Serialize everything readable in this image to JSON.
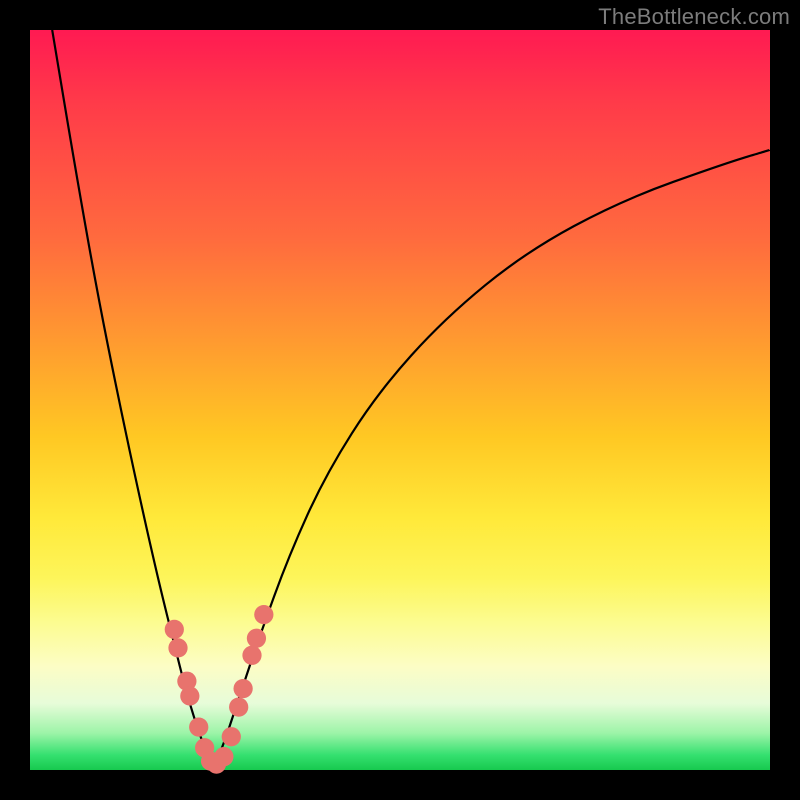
{
  "watermark": "TheBottleneck.com",
  "colors": {
    "curve": "#000000",
    "marker": "#e8736d",
    "frame": "#000000"
  },
  "chart_data": {
    "type": "line",
    "title": "",
    "xlabel": "",
    "ylabel": "",
    "xlim": [
      0,
      1
    ],
    "ylim": [
      0,
      1
    ],
    "annotations": [
      "TheBottleneck.com"
    ],
    "series": [
      {
        "name": "bottleneck-curve-left",
        "x": [
          0.03,
          0.06,
          0.09,
          0.12,
          0.15,
          0.175,
          0.195,
          0.21,
          0.225,
          0.238,
          0.248
        ],
        "y": [
          1.0,
          0.82,
          0.65,
          0.5,
          0.36,
          0.25,
          0.17,
          0.11,
          0.06,
          0.025,
          0.005
        ]
      },
      {
        "name": "bottleneck-curve-right",
        "x": [
          0.248,
          0.26,
          0.28,
          0.31,
          0.35,
          0.4,
          0.47,
          0.56,
          0.67,
          0.8,
          0.94,
          1.0
        ],
        "y": [
          0.005,
          0.03,
          0.09,
          0.18,
          0.29,
          0.4,
          0.51,
          0.61,
          0.7,
          0.77,
          0.82,
          0.838
        ]
      }
    ],
    "markers": {
      "name": "highlight-dots",
      "points": [
        {
          "x": 0.195,
          "y": 0.19
        },
        {
          "x": 0.2,
          "y": 0.165
        },
        {
          "x": 0.212,
          "y": 0.12
        },
        {
          "x": 0.216,
          "y": 0.1
        },
        {
          "x": 0.228,
          "y": 0.058
        },
        {
          "x": 0.236,
          "y": 0.03
        },
        {
          "x": 0.244,
          "y": 0.012
        },
        {
          "x": 0.252,
          "y": 0.008
        },
        {
          "x": 0.262,
          "y": 0.018
        },
        {
          "x": 0.272,
          "y": 0.045
        },
        {
          "x": 0.282,
          "y": 0.085
        },
        {
          "x": 0.288,
          "y": 0.11
        },
        {
          "x": 0.3,
          "y": 0.155
        },
        {
          "x": 0.306,
          "y": 0.178
        },
        {
          "x": 0.316,
          "y": 0.21
        }
      ],
      "radius_norm": 0.013
    }
  }
}
